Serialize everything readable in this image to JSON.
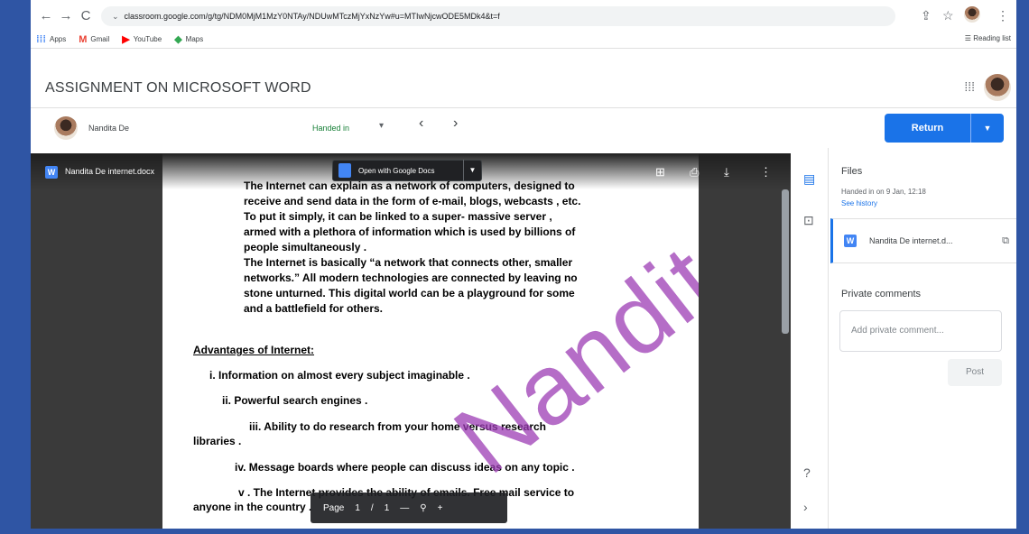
{
  "browser": {
    "url": "classroom.google.com/g/tg/NDM0MjM1MzY0NTAy/NDUwMTczMjYxNzYw#u=MTIwNjcwODE5MDk4&t=f",
    "bookmarks": [
      {
        "label": "Apps",
        "icon": "apps-grid-icon"
      },
      {
        "label": "Gmail",
        "icon": "gmail-icon"
      },
      {
        "label": "YouTube",
        "icon": "youtube-icon"
      },
      {
        "label": "Maps",
        "icon": "maps-icon"
      }
    ],
    "reading_list": "Reading list"
  },
  "classroom": {
    "assignment_title": "ASSIGNMENT ON MICROSOFT WORD",
    "student_name": "Nandita De",
    "status": "Handed in",
    "return_label": "Return"
  },
  "viewer": {
    "file_name": "Nandita De internet.docx",
    "open_with": "Open with Google Docs",
    "pager_label": "Page",
    "pager_current": "1",
    "pager_sep": "/",
    "pager_total": "1"
  },
  "document": {
    "para1": [
      "The Internet can explain as a network of computers, designed to",
      "receive and send data in the form of e-mail, blogs, webcasts , etc.",
      "To put it simply, it can be linked to a super- massive server ,",
      "armed with a plethora of information which is  used by billions of",
      "people simultaneously ."
    ],
    "para2": [
      "The Internet is basically “a network that connects other, smaller",
      "networks.” All modern technologies are connected by leaving no",
      "stone unturned. This digital world can be a playground for some",
      "and a battlefield for others."
    ],
    "heading": "Advantages of Internet:",
    "items": [
      "i.   Information on almost every subject imaginable .",
      "ii.        Powerful search engines .",
      "iii.        Ability to do research from your home versus research",
      "libraries .",
      "iv.   Message boards where people can discuss ideas on any topic .",
      "v . The Internet provides the ability of emails. Free mail service to",
      "anyone in the country ."
    ],
    "watermark": "Nandita De"
  },
  "side_panel": {
    "files_title": "Files",
    "handed_in_on": "Handed in on 9 Jan, 12:18",
    "see_history": "See history",
    "file_short": "Nandita De internet.d...",
    "private_comments": "Private comments",
    "comment_placeholder": "Add private comment...",
    "post_label": "Post"
  },
  "colors": {
    "frame": "#2f55a4",
    "accent": "#1a73e8",
    "handed_in": "#188038",
    "watermark": "#9c3cb4"
  }
}
